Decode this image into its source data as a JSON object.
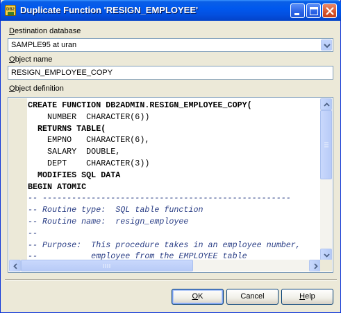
{
  "window": {
    "title": "Duplicate Function 'RESIGN_EMPLOYEE'",
    "icon": "db2-icon"
  },
  "destination": {
    "label_first": "D",
    "label_rest": "estination database",
    "value": "SAMPLE95 at uran"
  },
  "object_name": {
    "label_first": "O",
    "label_rest": "bject name",
    "value": "RESIGN_EMPLOYEE_COPY"
  },
  "object_definition": {
    "label_first": "O",
    "label_rest": "bject definition",
    "lines": [
      {
        "text": "CREATE FUNCTION DB2ADMIN.RESIGN_EMPLOYEE_COPY(",
        "type": "kw"
      },
      {
        "text": "    NUMBER  CHARACTER(6))",
        "type": "plain"
      },
      {
        "text": "  RETURNS TABLE(",
        "type": "kw"
      },
      {
        "text": "    EMPNO   CHARACTER(6),",
        "type": "plain"
      },
      {
        "text": "    SALARY  DOUBLE,",
        "type": "plain"
      },
      {
        "text": "    DEPT    CHARACTER(3))",
        "type": "plain"
      },
      {
        "text": "  MODIFIES SQL DATA",
        "type": "kw"
      },
      {
        "text": "BEGIN ATOMIC",
        "type": "kw"
      },
      {
        "text": "-- ---------------------------------------------------",
        "type": "comment"
      },
      {
        "text": "-- Routine type:  SQL table function",
        "type": "comment"
      },
      {
        "text": "-- Routine name:  resign_employee",
        "type": "comment"
      },
      {
        "text": "--",
        "type": "comment"
      },
      {
        "text": "-- Purpose:  This procedure takes in an employee number,",
        "type": "comment"
      },
      {
        "text": "--           employee from the EMPLOYEE table",
        "type": "comment"
      }
    ]
  },
  "buttons": {
    "ok": {
      "first": "O",
      "rest": "K"
    },
    "cancel": {
      "label": "Cancel"
    },
    "help": {
      "first": "H",
      "rest": "elp"
    }
  },
  "colors": {
    "titlebar": "#0058ee",
    "face": "#ece9d8",
    "border": "#7f9db9",
    "comment": "#2b3f86"
  }
}
